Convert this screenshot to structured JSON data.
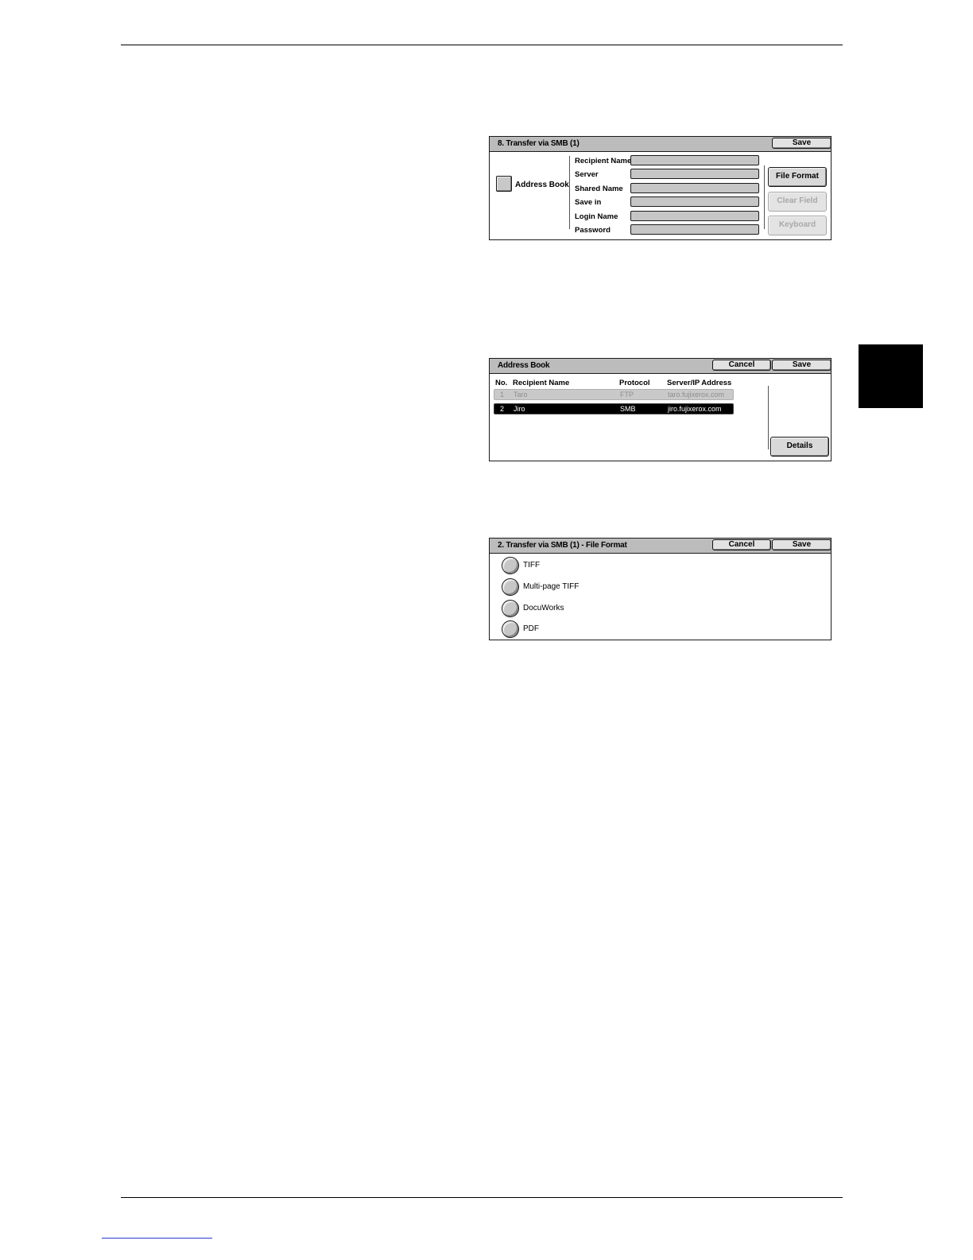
{
  "panel_smb": {
    "title": "8. Transfer via SMB (1)",
    "save_label": "Save",
    "address_book_label": "Address Book",
    "fields": [
      {
        "label": "Recipient Name",
        "value": ""
      },
      {
        "label": "Server",
        "value": ""
      },
      {
        "label": "Shared Name",
        "value": ""
      },
      {
        "label": "Save in",
        "value": ""
      },
      {
        "label": "Login Name",
        "value": ""
      },
      {
        "label": "Password",
        "value": ""
      }
    ],
    "file_format_label": "File Format",
    "clear_field_label": "Clear Field",
    "keyboard_label": "Keyboard"
  },
  "panel_address_book": {
    "title": "Address Book",
    "cancel_label": "Cancel",
    "save_label": "Save",
    "columns": [
      "No.",
      "Recipient Name",
      "Protocol",
      "Server/IP Address"
    ],
    "rows": [
      {
        "no": "1",
        "name": "Taro",
        "protocol": "FTP",
        "address": "taro.fujixerox.com"
      },
      {
        "no": "2",
        "name": "Jiro",
        "protocol": "SMB",
        "address": "jiro.fujixerox.com"
      }
    ],
    "details_label": "Details"
  },
  "panel_file_format": {
    "title": "2. Transfer via SMB (1) - File Format",
    "cancel_label": "Cancel",
    "save_label": "Save",
    "options": [
      "TIFF",
      "Multi-page TIFF",
      "DocuWorks",
      "PDF"
    ]
  }
}
